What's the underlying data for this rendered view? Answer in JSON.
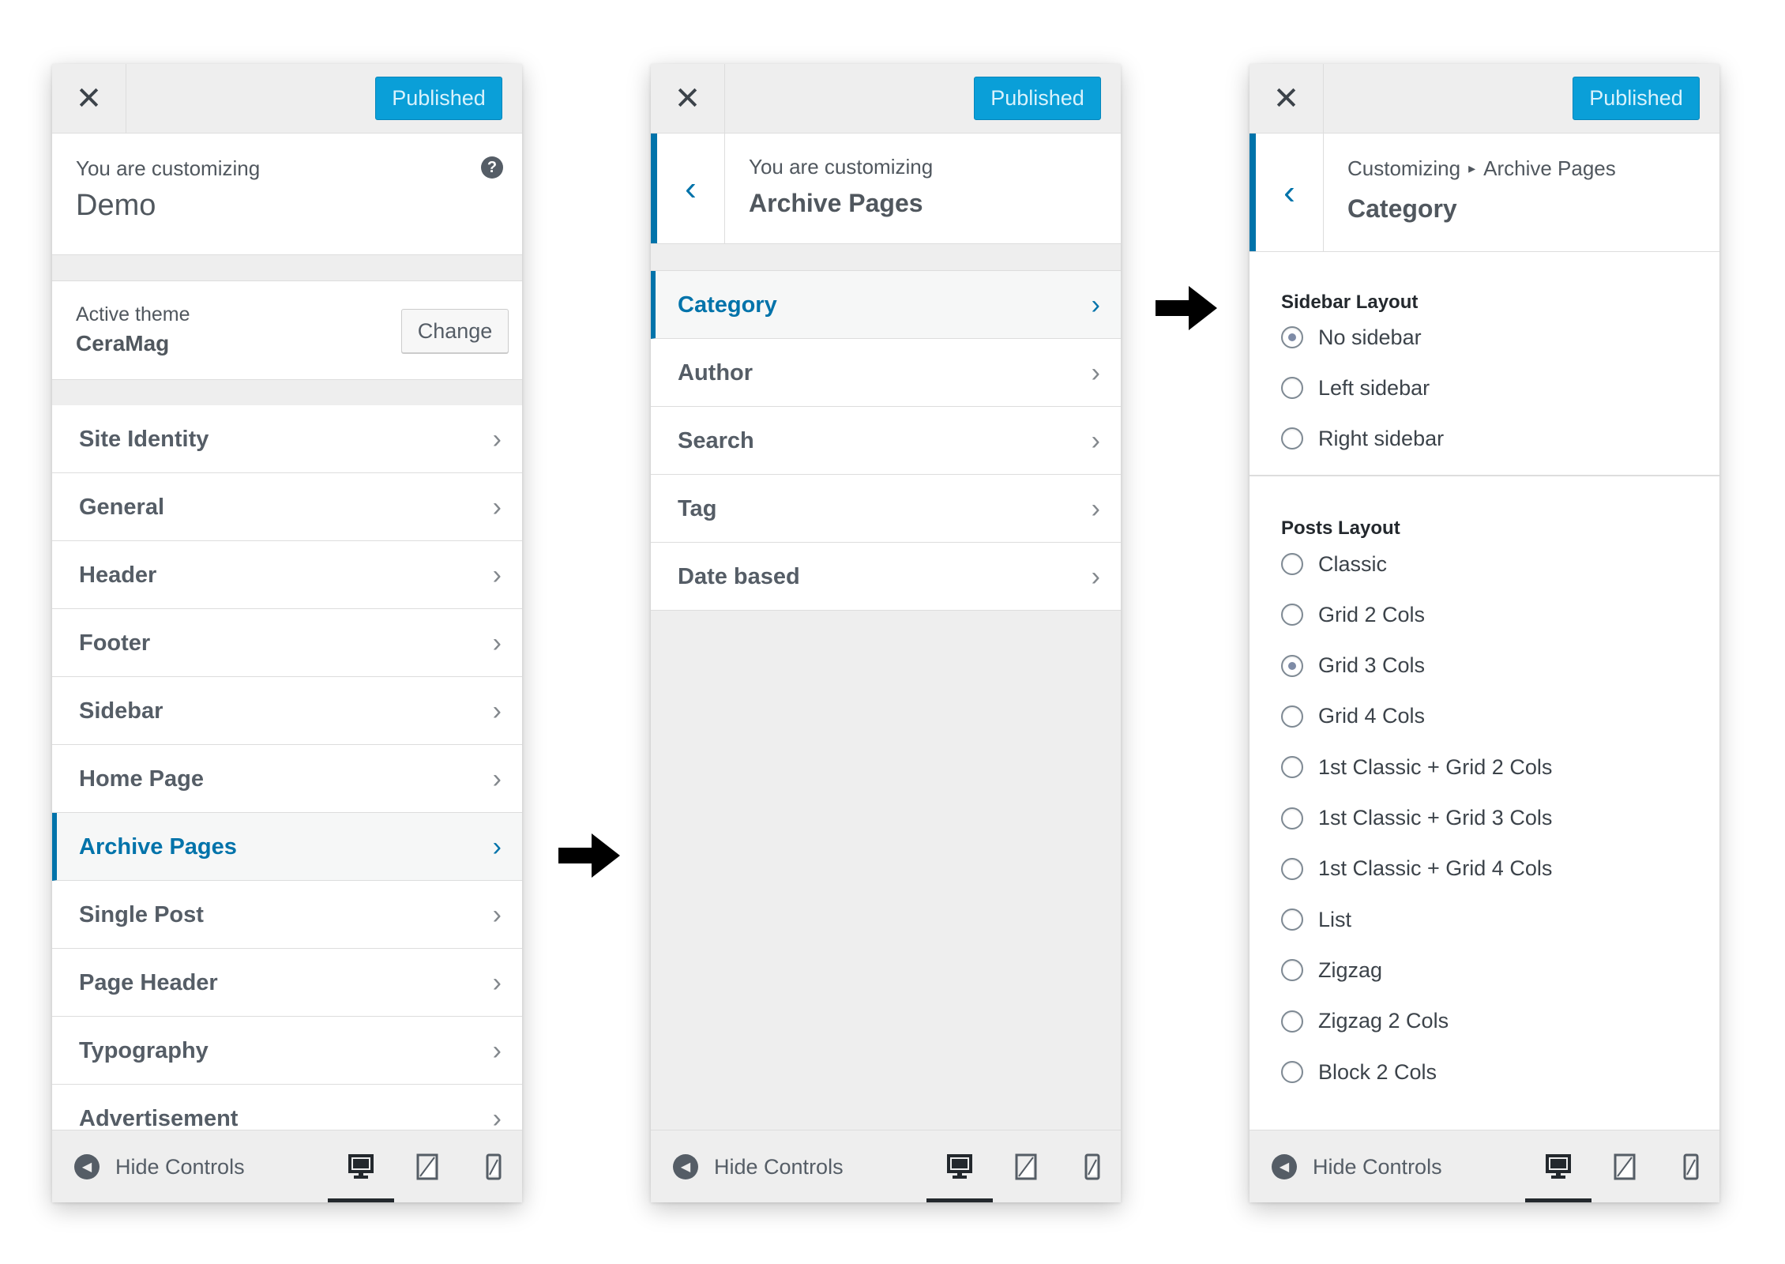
{
  "colors": {
    "accent": "#0073aa",
    "publish": "#0a9fd8",
    "panel_bg": "#eeeeee"
  },
  "panel1": {
    "publish_label": "Published",
    "close_icon": "close-icon",
    "info_small": "You are customizing",
    "info_title": "Demo",
    "help_glyph": "?",
    "theme": {
      "label": "Active theme",
      "name": "CeraMag",
      "change_label": "Change"
    },
    "menu": [
      "Site Identity",
      "General",
      "Header",
      "Footer",
      "Sidebar",
      "Home Page",
      "Archive Pages",
      "Single Post",
      "Page Header",
      "Typography",
      "Advertisement"
    ],
    "active_item": "Archive Pages",
    "hide_controls": "Hide Controls"
  },
  "panel2": {
    "publish_label": "Published",
    "info_small": "You are customizing",
    "info_title": "Archive Pages",
    "menu": [
      "Category",
      "Author",
      "Search",
      "Tag",
      "Date based"
    ],
    "active_item": "Category",
    "hide_controls": "Hide Controls"
  },
  "panel3": {
    "publish_label": "Published",
    "breadcrumb_root": "Customizing",
    "breadcrumb_sep": "▸",
    "breadcrumb_parent": "Archive Pages",
    "info_title": "Category",
    "sidebar_layout": {
      "title": "Sidebar Layout",
      "options": [
        "No sidebar",
        "Left sidebar",
        "Right sidebar"
      ],
      "selected": "No sidebar"
    },
    "posts_layout": {
      "title": "Posts Layout",
      "options": [
        "Classic",
        "Grid 2 Cols",
        "Grid 3 Cols",
        "Grid 4 Cols",
        "1st Classic + Grid 2 Cols",
        "1st Classic + Grid 3 Cols",
        "1st Classic + Grid 4 Cols",
        "List",
        "Zigzag",
        "Zigzag 2 Cols",
        "Block 2 Cols"
      ],
      "selected": "Grid 3 Cols"
    },
    "hide_controls": "Hide Controls"
  },
  "device_icons": [
    "desktop-icon",
    "tablet-icon",
    "mobile-icon"
  ],
  "active_device": "desktop-icon",
  "flow_arrows": [
    "arrow-right-icon",
    "arrow-right-icon"
  ]
}
